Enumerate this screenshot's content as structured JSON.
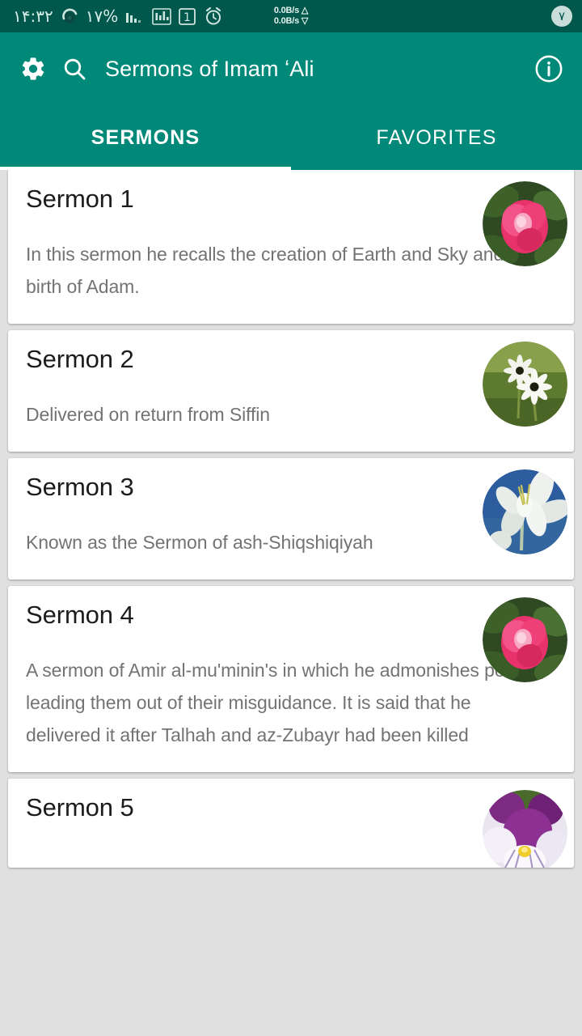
{
  "statusbar": {
    "time": "١۴:٣٢",
    "battery": "١٧%",
    "icons": [
      "signal-bars-icon",
      "data-usage-icon",
      "sim-one-icon",
      "alarm-clock-icon"
    ],
    "network_up": "0.0B/s △",
    "network_down": "0.0B/s ▽",
    "badge": "٧",
    "background_color": "#00574B"
  },
  "appbar": {
    "settings_icon": "gear-icon",
    "search_icon": "search-icon",
    "title": "Sermons of Imam ʻAli",
    "info_icon": "info-icon",
    "background_color": "#008878"
  },
  "tabs": [
    {
      "label": "SERMONS",
      "active": true
    },
    {
      "label": "FAVORITES",
      "active": false
    }
  ],
  "list": {
    "items": [
      {
        "title": "Sermon 1",
        "description": "In this sermon he recalls the creation of Earth and Sky and the birth of Adam.",
        "thumbnail": "pink-rose-photo"
      },
      {
        "title": "Sermon 2",
        "description": "Delivered on return from Siffin",
        "thumbnail": "white-daisies-photo"
      },
      {
        "title": "Sermon 3",
        "description": "Known as the Sermon of ash-Shiqshiqiyah",
        "thumbnail": "white-lily-photo"
      },
      {
        "title": "Sermon 4",
        "description": "A sermon of Amir al-mu'minin's  in which he admonishes people, leading them out of their misguidance. It is said that he delivered it after Talhah and az-Zubayr had been killed",
        "thumbnail": "pink-rose-photo"
      },
      {
        "title": "Sermon 5",
        "description": "",
        "thumbnail": "purple-pansy-photo"
      }
    ]
  }
}
